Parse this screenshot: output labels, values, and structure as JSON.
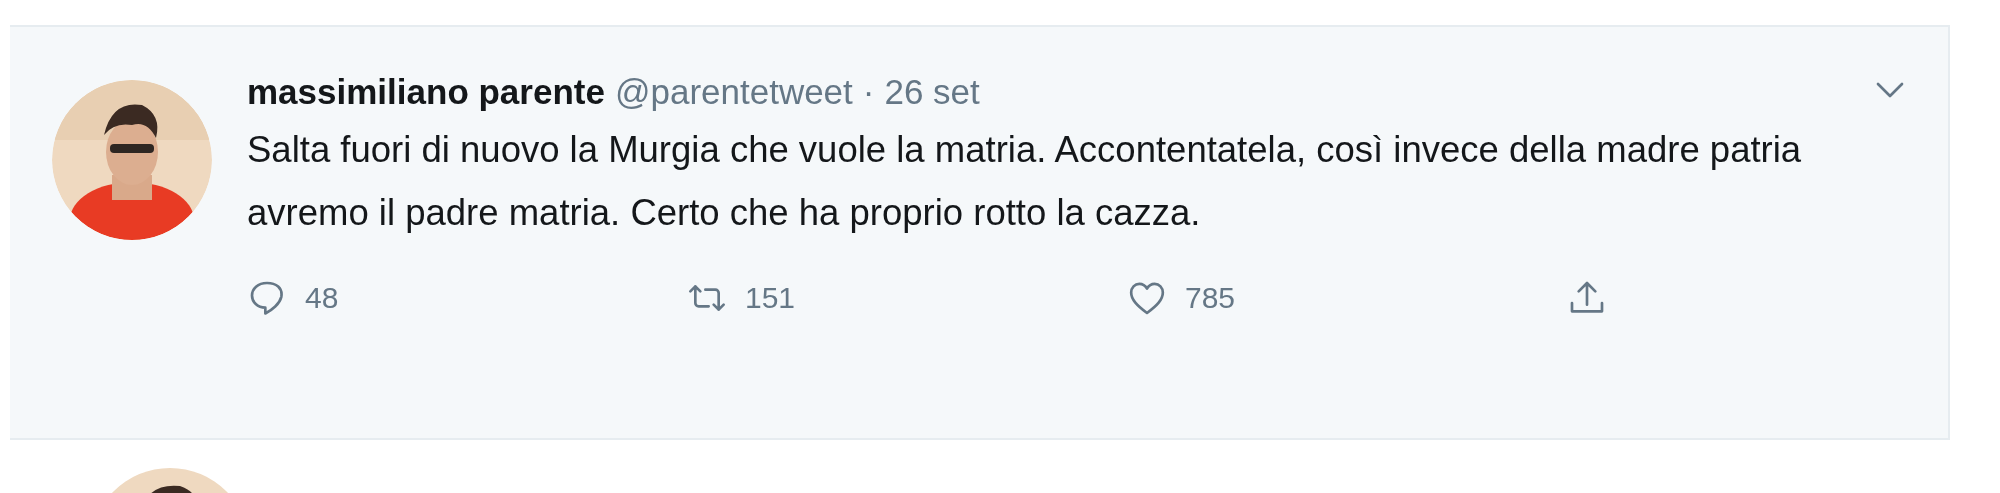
{
  "tweet": {
    "name": "massimiliano parente",
    "handle": "@parentetweet",
    "separator": "·",
    "date": "26 set",
    "text": "Salta fuori di nuovo la Murgia che vuole la matria. Accontentatela, così invece della madre patria avremo il padre matria. Certo che ha proprio rotto la cazza.",
    "actions": [
      {
        "kind": "reply",
        "count": "48"
      },
      {
        "kind": "retweet",
        "count": "151"
      },
      {
        "kind": "like",
        "count": "785"
      },
      {
        "kind": "share"
      }
    ]
  }
}
